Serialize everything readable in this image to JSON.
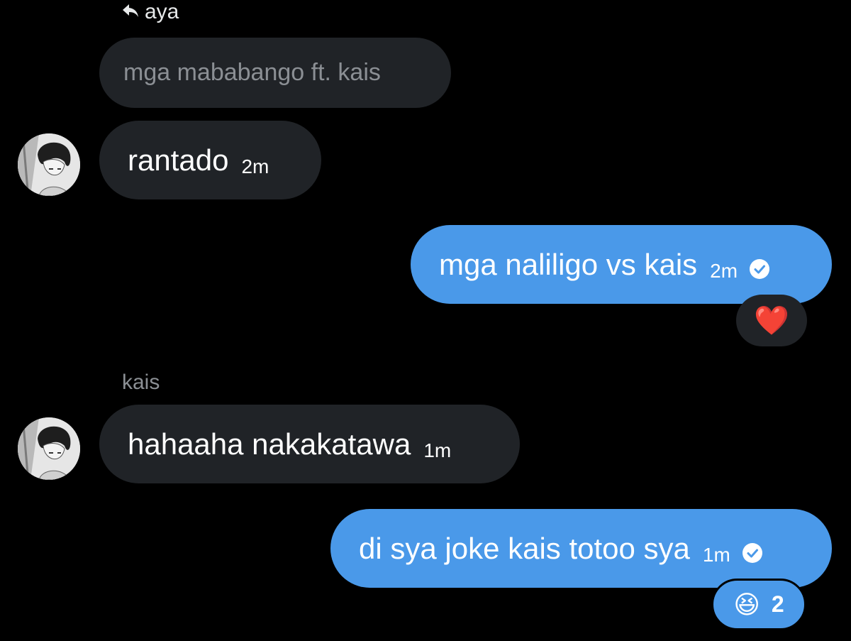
{
  "reply": {
    "to_name": "aya",
    "quoted_text": "mga mababango ft. kais"
  },
  "messages": [
    {
      "text": "rantado",
      "time": "2m"
    },
    {
      "text": "mga naliligo vs kais",
      "time": "2m",
      "reaction": "❤️"
    },
    {
      "sender": "kais",
      "text": "hahaaha nakakatawa",
      "time": "1m"
    },
    {
      "text": "di sya joke kais totoo sya",
      "time": "1m",
      "reaction": "😆",
      "reaction_count": "2"
    }
  ],
  "colors": {
    "background": "#000000",
    "incoming_bubble": "#202327",
    "outgoing_bubble": "#4a99e9",
    "muted_text": "#8b8f94"
  },
  "icons": [
    "reply-arrow-icon",
    "sent-check-icon",
    "avatar"
  ]
}
